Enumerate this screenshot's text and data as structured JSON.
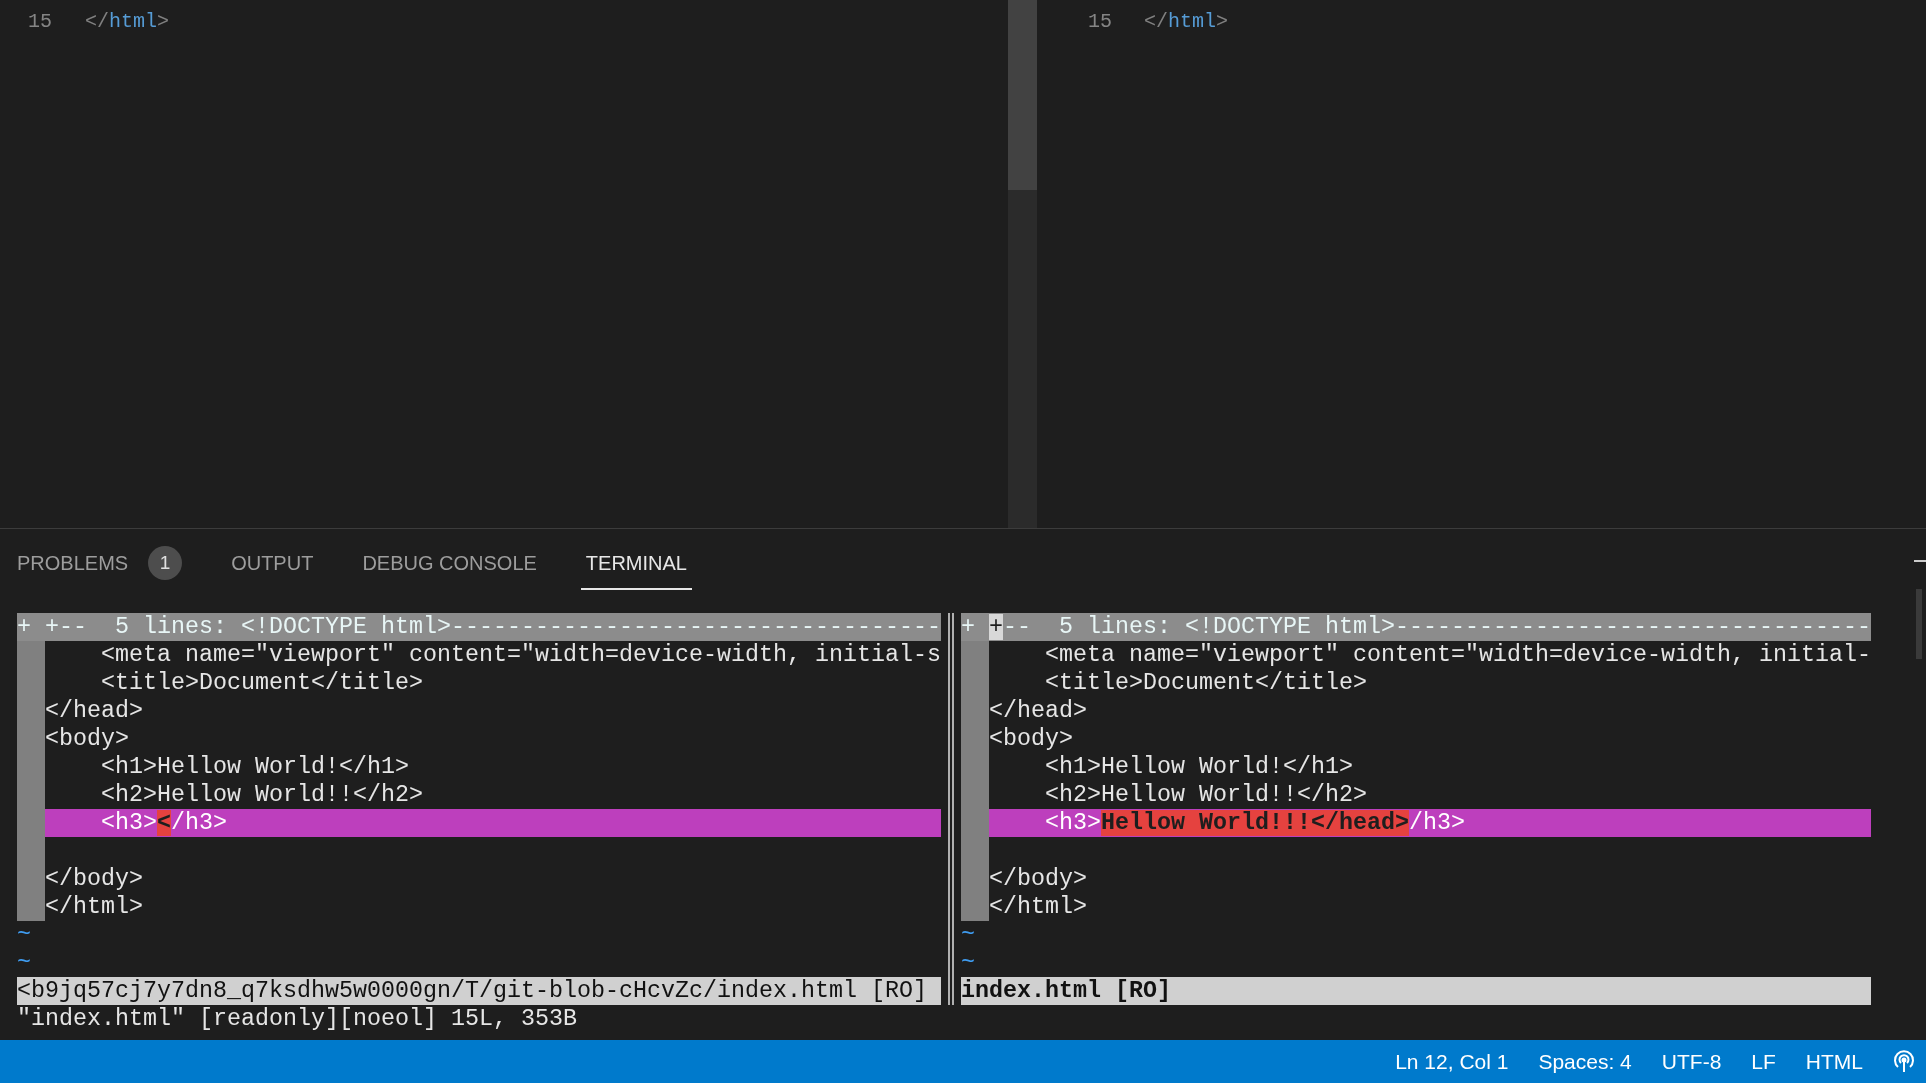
{
  "editor": {
    "panes": [
      {
        "line_number": "15",
        "code": [
          {
            "kind": "punct",
            "text": "</"
          },
          {
            "kind": "tag",
            "text": "html"
          },
          {
            "kind": "punct",
            "text": ">"
          }
        ]
      },
      {
        "line_number": "15",
        "code": [
          {
            "kind": "punct",
            "text": "</"
          },
          {
            "kind": "tag",
            "text": "html"
          },
          {
            "kind": "punct",
            "text": ">"
          }
        ]
      }
    ]
  },
  "panel": {
    "tabs": [
      {
        "label": "PROBLEMS",
        "badge": "1",
        "selected": false
      },
      {
        "label": "OUTPUT",
        "selected": false
      },
      {
        "label": "DEBUG CONSOLE",
        "selected": false
      },
      {
        "label": "TERMINAL",
        "selected": true
      }
    ]
  },
  "terminal": {
    "panes": [
      {
        "current": false,
        "status": "<b9jq57cj7y7dn8_q7ksdhw5w0000gn/T/git-blob-cHcvZc/index.html [RO]",
        "lines": [
          {
            "kind": "fold",
            "sign": "+",
            "cursor": false,
            "text": "+--  5 lines: <!DOCTYPE html>-----------------------------------"
          },
          {
            "kind": "text",
            "text": "    <meta name=\"viewport\" content=\"width=device-width, initial-s"
          },
          {
            "kind": "text",
            "text": "    <title>Document</title>"
          },
          {
            "kind": "text",
            "text": "</head>"
          },
          {
            "kind": "text",
            "text": "<body>"
          },
          {
            "kind": "text",
            "text": "    <h1>Hellow World!</h1>"
          },
          {
            "kind": "text",
            "text": "    <h2>Hellow World!!</h2>"
          },
          {
            "kind": "changed",
            "segments": [
              {
                "text": "    <h3>",
                "changed": false
              },
              {
                "text": "<",
                "changed": true
              },
              {
                "text": "/h3>",
                "changed": false
              }
            ]
          },
          {
            "kind": "blank"
          },
          {
            "kind": "text",
            "text": "</body>"
          },
          {
            "kind": "text",
            "text": "</html>"
          },
          {
            "kind": "filler",
            "text": "~"
          },
          {
            "kind": "filler",
            "text": "~"
          }
        ]
      },
      {
        "current": true,
        "status": "index.html [RO]",
        "lines": [
          {
            "kind": "fold",
            "sign": "+",
            "cursor": true,
            "text": "+--  5 lines: <!DOCTYPE html>----------------------------------"
          },
          {
            "kind": "text",
            "text": "    <meta name=\"viewport\" content=\"width=device-width, initial-"
          },
          {
            "kind": "text",
            "text": "    <title>Document</title>"
          },
          {
            "kind": "text",
            "text": "</head>"
          },
          {
            "kind": "text",
            "text": "<body>"
          },
          {
            "kind": "text",
            "text": "    <h1>Hellow World!</h1>"
          },
          {
            "kind": "text",
            "text": "    <h2>Hellow World!!</h2>"
          },
          {
            "kind": "changed",
            "segments": [
              {
                "text": "    <h3>",
                "changed": false
              },
              {
                "text": "Hellow World!!!</head>",
                "changed": true
              },
              {
                "text": "/h3>",
                "changed": false
              }
            ]
          },
          {
            "kind": "blank"
          },
          {
            "kind": "text",
            "text": "</body>"
          },
          {
            "kind": "text",
            "text": "</html>"
          },
          {
            "kind": "filler",
            "text": "~"
          },
          {
            "kind": "filler",
            "text": "~"
          }
        ]
      }
    ],
    "message": "\"index.html\" [readonly][noeol] 15L, 353B"
  },
  "status_bar": {
    "items": [
      "Ln 12, Col 1",
      "Spaces: 4",
      "UTF-8",
      "LF",
      "HTML"
    ]
  }
}
